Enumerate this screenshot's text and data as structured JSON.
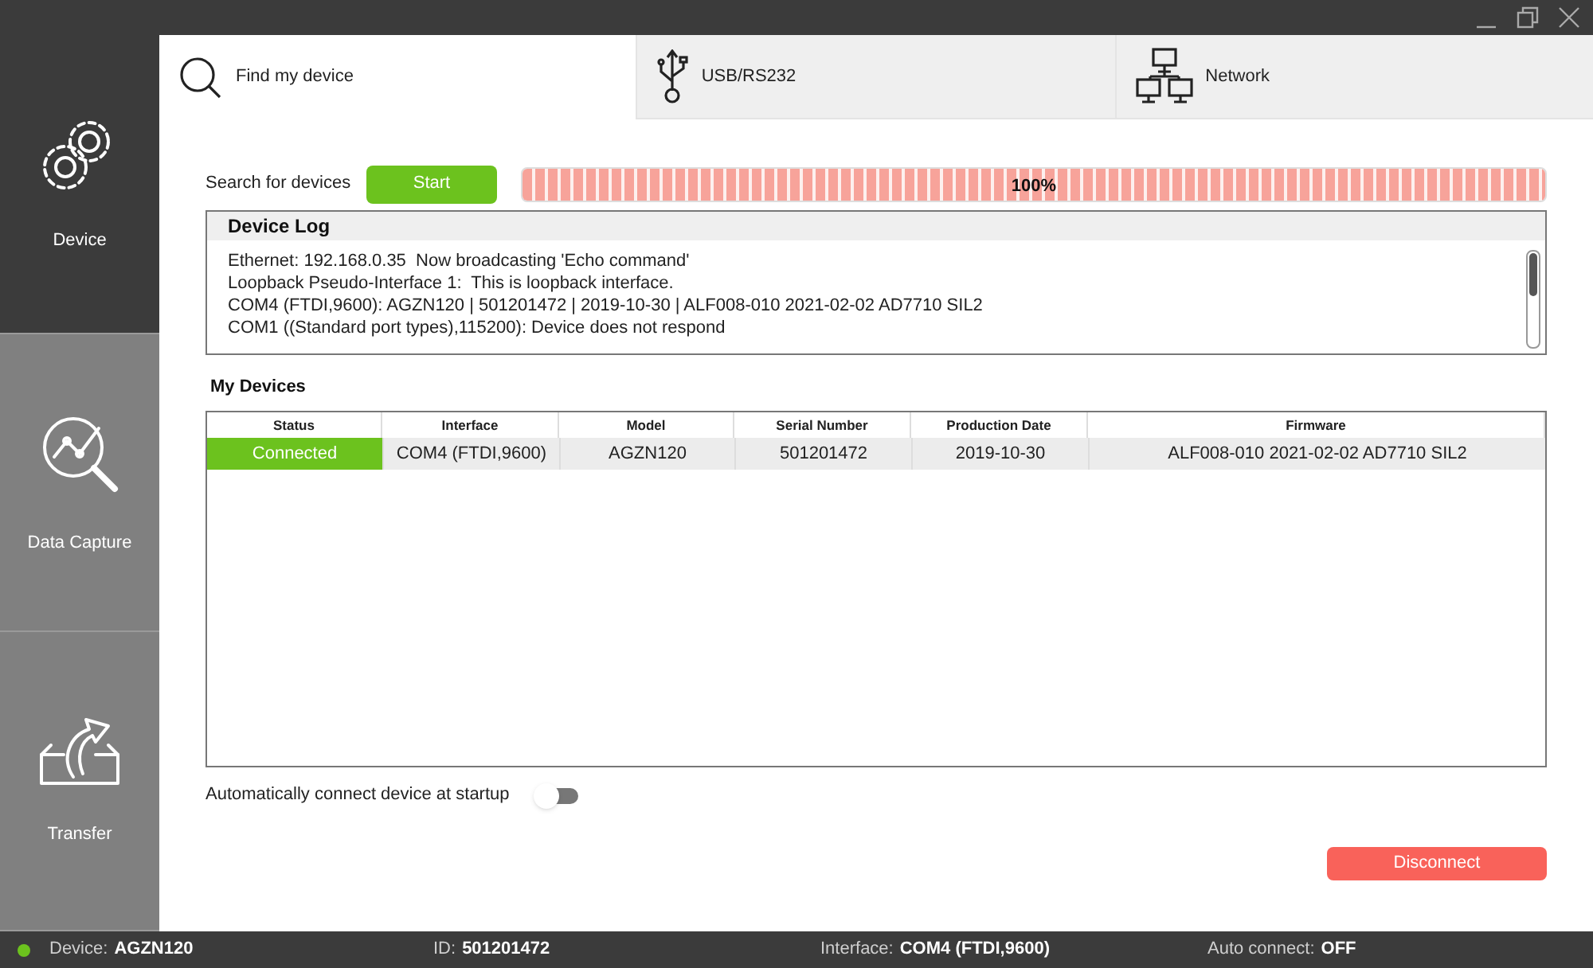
{
  "sidebar": {
    "items": [
      {
        "label": "Device",
        "selected": true
      },
      {
        "label": "Data Capture",
        "selected": false
      },
      {
        "label": "Transfer",
        "selected": false
      }
    ]
  },
  "tabs": [
    {
      "label": "Find my device",
      "selected": true
    },
    {
      "label": "USB/RS232",
      "selected": false
    },
    {
      "label": "Network",
      "selected": false
    }
  ],
  "search": {
    "label": "Search for devices",
    "button": "Start",
    "progress": {
      "level": 1,
      "reading": "100%"
    }
  },
  "log": {
    "title": "Device Log",
    "lines": [
      "Ethernet: 192.168.0.35  Now broadcasting 'Echo command'",
      "Loopback Pseudo-Interface 1:  This is loopback interface.",
      "COM4 (FTDI,9600): AGZN120 | 501201472 | 2019-10-30 | ALF008-010 2021-02-02 AD7710 SIL2",
      "COM1 ((Standard port types),115200): Device does not respond"
    ]
  },
  "devices": {
    "title": "My Devices",
    "columns": [
      "Status",
      "Interface",
      "Model",
      "Serial Number",
      "Production Date",
      "Firmware"
    ],
    "rows": [
      {
        "connected": true,
        "selected": true,
        "cells": [
          "Connected",
          "COM4 (FTDI,9600)",
          "AGZN120",
          "501201472",
          "2019-10-30",
          "ALF008-010 2021-02-02 AD7710 SIL2"
        ]
      }
    ]
  },
  "auto_connect": {
    "label": "Automatically connect device at startup",
    "on": false
  },
  "disconnect_button": "Disconnect",
  "status_bar": {
    "connected": true,
    "items": [
      {
        "label": "Device:",
        "value": "AGZN120"
      },
      {
        "label": "ID:",
        "value": "501201472"
      },
      {
        "label": "Interface:",
        "value": "COM4 (FTDI,9600)"
      },
      {
        "label": "Auto connect:",
        "value": "OFF"
      }
    ]
  }
}
